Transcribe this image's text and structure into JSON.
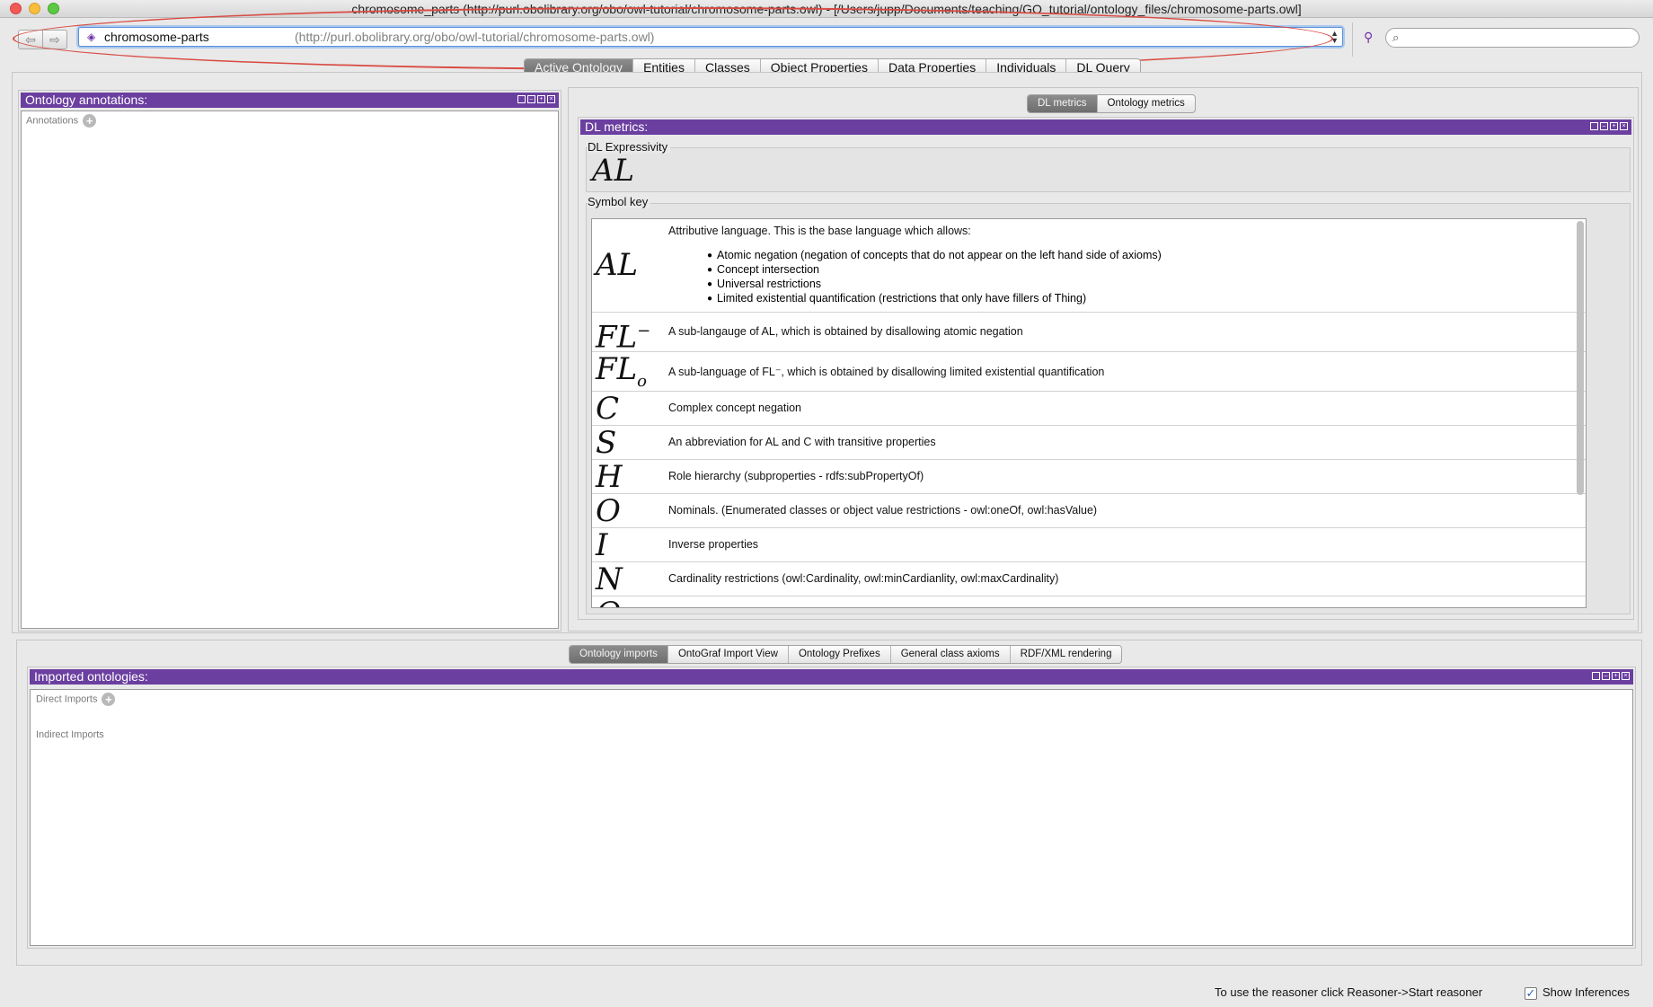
{
  "window": {
    "title": "chromosome_parts (http://purl.obolibrary.org/obo/owl-tutorial/chromosome-parts.owl) - [/Users/jupp/Documents/teaching/GO_tutorial/ontology_files/chromosome-parts.owl]"
  },
  "toolbar": {
    "back_glyph": "⇦",
    "forward_glyph": "⇨",
    "ontology_icon": "diamond-icon",
    "ontology_name": "chromosome-parts",
    "ontology_uri": "(http://purl.obolibrary.org/obo/owl-tutorial/chromosome-parts.owl)",
    "search_value": ""
  },
  "main_tabs": [
    {
      "label": "Active Ontology",
      "active": true
    },
    {
      "label": "Entities",
      "active": false
    },
    {
      "label": "Classes",
      "active": false
    },
    {
      "label": "Object Properties",
      "active": false
    },
    {
      "label": "Data Properties",
      "active": false
    },
    {
      "label": "Individuals",
      "active": false
    },
    {
      "label": "DL Query",
      "active": false
    }
  ],
  "annotations_view": {
    "title": "Ontology annotations:",
    "annotations_label": "Annotations"
  },
  "metrics_tabs": [
    {
      "label": "DL metrics",
      "active": true
    },
    {
      "label": "Ontology metrics",
      "active": false
    }
  ],
  "dl_metrics": {
    "title": "DL metrics:",
    "expressivity_label": "DL Expressivity",
    "expressivity_value": "AL",
    "symbol_key_label": "Symbol key",
    "symbols": [
      {
        "symbol": "AL",
        "description": "Attributive language. This is the base language which allows:",
        "bullets": [
          "Atomic negation (negation of concepts that do not appear on the left hand side of axioms)",
          "Concept intersection",
          "Universal restrictions",
          "Limited existential quantification (restrictions that only have fillers of Thing)"
        ]
      },
      {
        "symbol": "FL",
        "sup": "−",
        "description": "A sub-langauge of AL, which is obtained by disallowing atomic negation"
      },
      {
        "symbol": "FL",
        "sub": "o",
        "description": "A sub-language of FL⁻, which is obtained by disallowing limited existential quantification"
      },
      {
        "symbol": "C",
        "description": "Complex concept negation"
      },
      {
        "symbol": "S",
        "description": "An abbreviation for AL and C with transitive properties"
      },
      {
        "symbol": "H",
        "description": "Role hierarchy (subproperties - rdfs:subPropertyOf)"
      },
      {
        "symbol": "O",
        "description": "Nominals. (Enumerated classes or object value restrictions - owl:oneOf, owl:hasValue)"
      },
      {
        "symbol": "I",
        "description": "Inverse properties"
      },
      {
        "symbol": "N",
        "description": "Cardinality restrictions (owl:Cardinality, owl:minCardianlity, owl:maxCardinality)"
      },
      {
        "symbol": "Q",
        "description": ""
      }
    ]
  },
  "bottom_tabs": [
    {
      "label": "Ontology imports",
      "active": true
    },
    {
      "label": "OntoGraf Import View",
      "active": false
    },
    {
      "label": "Ontology Prefixes",
      "active": false
    },
    {
      "label": "General class axioms",
      "active": false
    },
    {
      "label": "RDF/XML rendering",
      "active": false
    }
  ],
  "imports_view": {
    "title": "Imported ontologies:",
    "direct_label": "Direct Imports",
    "indirect_label": "Indirect Imports"
  },
  "status_bar": {
    "reasoner_hint": "To use the reasoner click Reasoner->Start reasoner",
    "show_inferences_label": "Show Inferences",
    "show_inferences_checked": true
  },
  "colors": {
    "view_header": "#6b3fa0",
    "highlight_oval": "#d94b43"
  }
}
